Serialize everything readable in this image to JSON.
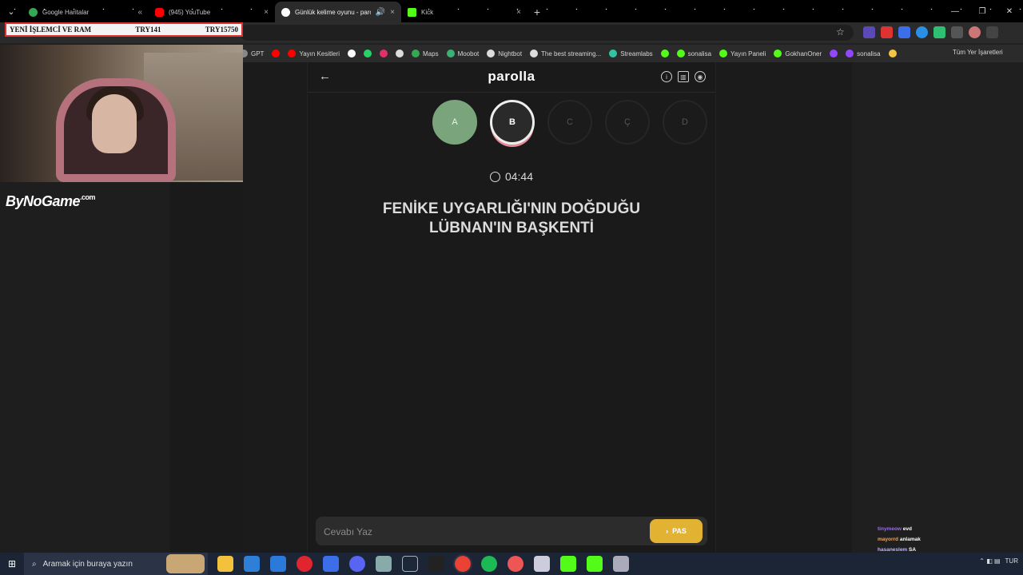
{
  "tabs": [
    {
      "title": "Google Haritalar",
      "fav_color": "#34a853",
      "active": false
    },
    {
      "title": "(945) YouTube",
      "fav_color": "#ff0000",
      "active": false
    },
    {
      "title": "Günlük kelime oyunu - parolla",
      "fav_color": "#ffffff",
      "active": true
    },
    {
      "title": "Kick",
      "fav_color": "#53fc18",
      "active": false
    }
  ],
  "bookmarks": [
    {
      "label": "GPT",
      "color": "#888"
    },
    {
      "label": "",
      "color": "#ff0000"
    },
    {
      "label": "Yayın Kesitleri",
      "color": "#ff0000"
    },
    {
      "label": "",
      "color": "#ffffff"
    },
    {
      "label": "",
      "color": "#25d366"
    },
    {
      "label": "",
      "color": "#e1306c"
    },
    {
      "label": "",
      "color": "#dddddd"
    },
    {
      "label": "Maps",
      "color": "#34a853"
    },
    {
      "label": "Moobot",
      "color": "#3bb273"
    },
    {
      "label": "Nightbot",
      "color": "#dddddd"
    },
    {
      "label": "The best streaming...",
      "color": "#dddddd"
    },
    {
      "label": "Streamlabs",
      "color": "#31c3a2"
    },
    {
      "label": "",
      "color": "#53fc18"
    },
    {
      "label": "sonalisa",
      "color": "#53fc18"
    },
    {
      "label": "Yayın Paneli",
      "color": "#53fc18"
    },
    {
      "label": "GokhanOner",
      "color": "#53fc18"
    },
    {
      "label": "",
      "color": "#9146ff"
    },
    {
      "label": "sonalisa",
      "color": "#9146ff"
    },
    {
      "label": "",
      "color": "#f4c542"
    }
  ],
  "bookmarks_all": "Tüm Yer İşaretleri",
  "ticker": {
    "left": "YENİ İŞLEMCİ VE RAM",
    "mid": "TRY141",
    "right": "TRY15750"
  },
  "overlay_brand": {
    "main": "ByNoGame",
    "suffix": ".com"
  },
  "game": {
    "logo": "parolla",
    "letters": [
      {
        "letter": "A",
        "state": "done"
      },
      {
        "letter": "B",
        "state": "current"
      },
      {
        "letter": "C",
        "state": "pending"
      },
      {
        "letter": "Ç",
        "state": "pending"
      },
      {
        "letter": "D",
        "state": "pending"
      }
    ],
    "timer": "04:44",
    "question_line1": "FENİKE UYGARLIĞI'NIN DOĞDUĞU",
    "question_line2": "LÜBNAN'IN BAŞKENTİ",
    "answer_placeholder": "Cevabı Yaz",
    "pass_label": "PAS"
  },
  "chat": [
    {
      "user": "tinymeow",
      "msg": "evd"
    },
    {
      "user": "mayorrd",
      "msg": "anlamak"
    },
    {
      "user": "hasaneslem",
      "msg": "SA"
    }
  ],
  "taskbar": {
    "search_placeholder": "Aramak için buraya yazın",
    "lang": "TUR"
  }
}
